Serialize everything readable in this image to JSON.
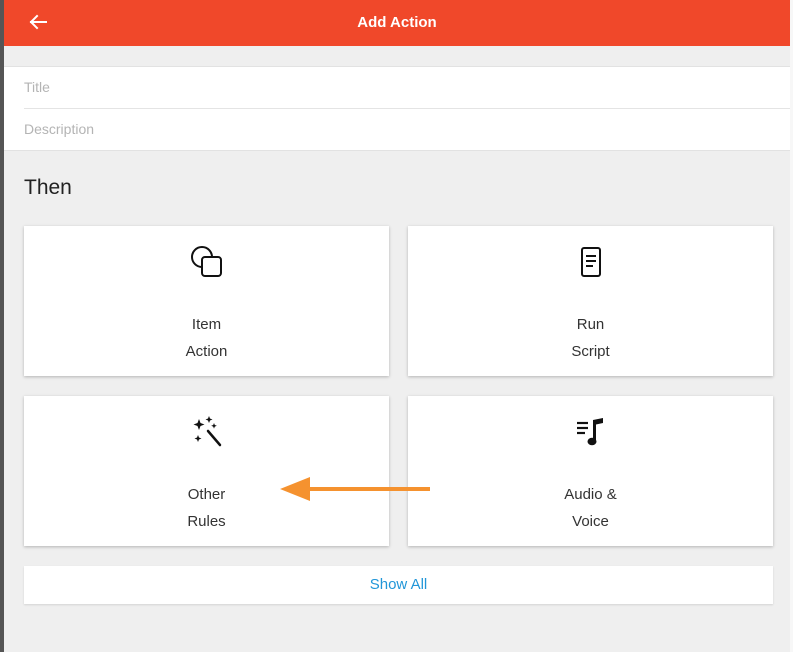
{
  "header": {
    "title": "Add Action",
    "back_icon": "arrow-left-icon",
    "background": "#f0482a"
  },
  "form": {
    "title_placeholder": "Title",
    "description_placeholder": "Description"
  },
  "section": {
    "title": "Then"
  },
  "cards": [
    {
      "icon": "item-shapes-icon",
      "line1": "Item",
      "line2": "Action"
    },
    {
      "icon": "script-document-icon",
      "line1": "Run",
      "line2": "Script"
    },
    {
      "icon": "magic-wand-icon",
      "line1": "Other",
      "line2": "Rules"
    },
    {
      "icon": "music-list-icon",
      "line1": "Audio &",
      "line2": "Voice"
    }
  ],
  "show_all": {
    "label": "Show All",
    "color": "#2196d8"
  },
  "annotation": {
    "color": "#f5922f"
  }
}
